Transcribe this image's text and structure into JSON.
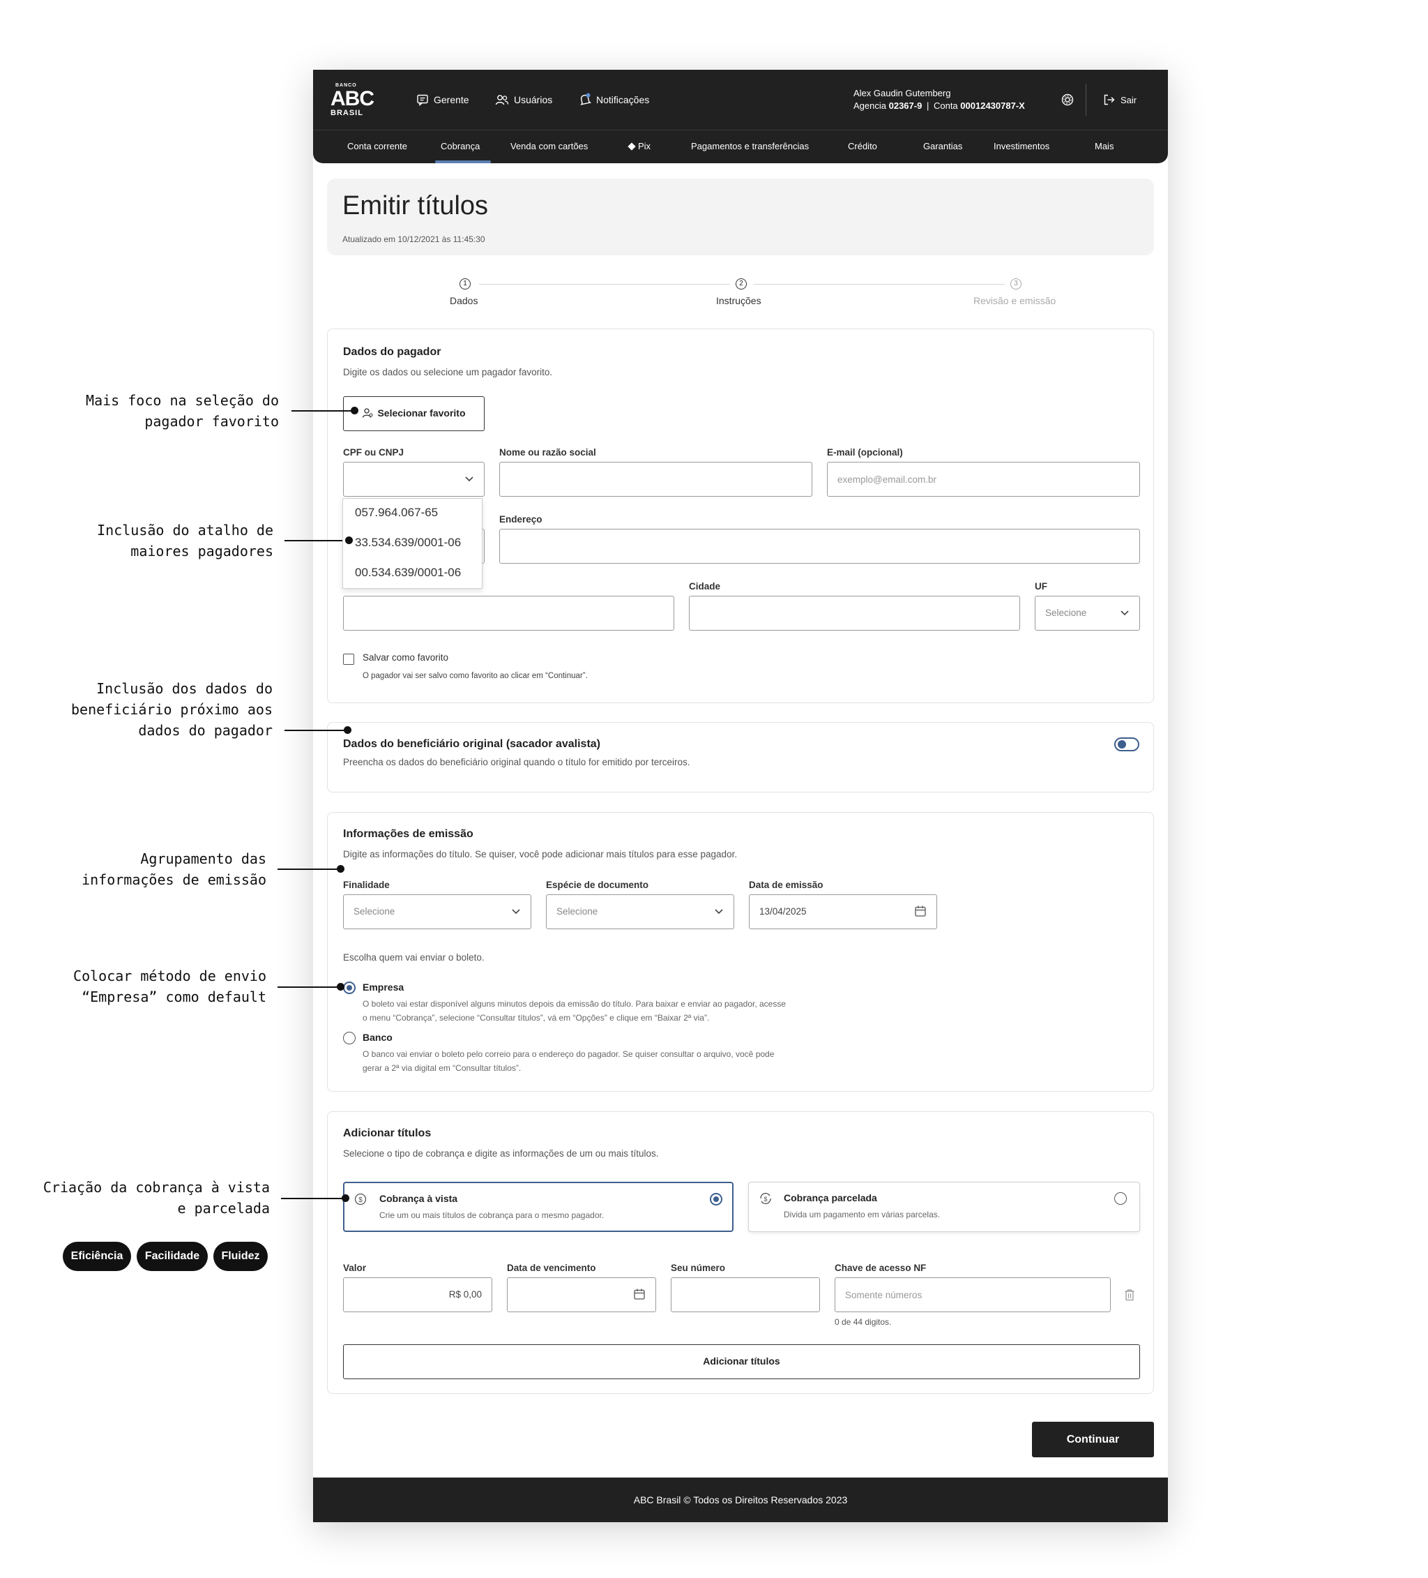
{
  "app": {
    "logo": {
      "small": "BANCO",
      "main": "ABC",
      "sub": "BRASIL"
    },
    "top_nav": [
      {
        "label": "Gerente",
        "icon": "chat-icon"
      },
      {
        "label": "Usuários",
        "icon": "users-icon"
      },
      {
        "label": "Notificações",
        "icon": "bell-icon"
      }
    ],
    "user": {
      "name": "Alex Gaudin Gutemberg",
      "agency_label": "Agencia",
      "agency": "02367-9",
      "account_label": "Conta",
      "account": "00012430787-X",
      "separator": "|"
    },
    "logout_label": "Sair",
    "main_nav": [
      "Conta corrente",
      "Cobrança",
      "Venda com cartões",
      "Pix",
      "Pagamentos e transferências",
      "Crédito",
      "Garantias",
      "Investimentos",
      "Mais"
    ],
    "active_nav": "Cobrança"
  },
  "page": {
    "title": "Emitir títulos",
    "updated": "Atualizado em 10/12/2021 às 11:45:30"
  },
  "stepper": [
    {
      "num": "1",
      "label": "Dados",
      "state": "active"
    },
    {
      "num": "2",
      "label": "Instruções",
      "state": "active"
    },
    {
      "num": "3",
      "label": "Revisão e emissão",
      "state": "inactive"
    }
  ],
  "payer": {
    "title": "Dados do pagador",
    "subtitle": "Digite os dados ou selecione um pagador favorito.",
    "select_favorite_label": "Selecionar favorito",
    "cpf_label": "CPF ou CNPJ",
    "name_label": "Nome ou razão social",
    "email_label": "E-mail (opcional)",
    "email_placeholder": "exemplo@email.com.br",
    "address_label": "Endereço",
    "city_label": "Cidade",
    "uf_label": "UF",
    "uf_placeholder": "Selecione",
    "cpf_options": [
      "057.964.067-65",
      "33.534.639/0001-06",
      "00.534.639/0001-06"
    ],
    "save_favorite_label": "Salvar como favorito",
    "save_favorite_hint": "O pagador vai ser salvo como favorito ao clicar em “Continuar”."
  },
  "beneficiary": {
    "title": "Dados do beneficiário original (sacador avalista)",
    "subtitle": "Preencha os dados do beneficiário original quando o título for emitido por terceiros.",
    "toggle_on": true
  },
  "emission": {
    "title": "Informações de emissão",
    "subtitle": "Digite as informações do título. Se quiser, você pode adicionar mais títulos para esse pagador.",
    "purpose_label": "Finalidade",
    "purpose_placeholder": "Selecione",
    "doc_type_label": "Espécie de documento",
    "doc_type_placeholder": "Selecione",
    "date_label": "Data de emissão",
    "date_value": "13/04/2025",
    "sender_question": "Escolha quem vai enviar o boleto.",
    "options": [
      {
        "label": "Empresa",
        "selected": true,
        "desc1": "O boleto vai estar disponível alguns minutos depois da emissão do título. Para baixar e enviar ao pagador, acesse",
        "desc2": "o menu “Cobrança”, selecione “Consultar títulos”, vá em “Opções” e clique em “Baixar 2ª via”."
      },
      {
        "label": "Banco",
        "selected": false,
        "desc1": "O banco vai enviar o boleto pelo correio para o endereço do pagador. Se quiser consultar o arquivo, você pode",
        "desc2": "gerar a 2ª via digital em “Consultar títulos”."
      }
    ]
  },
  "titles": {
    "title": "Adicionar títulos",
    "subtitle": "Selecione o tipo de cobrança e digite as informações de um ou mais títulos.",
    "choices": [
      {
        "label": "Cobrança à vista",
        "desc": "Crie um ou mais títulos de cobrança para o mesmo pagador.",
        "selected": true,
        "icon": "dollar-circle-icon"
      },
      {
        "label": "Cobrança parcelada",
        "desc": "Divida um pagamento em várias parcelas.",
        "selected": false,
        "icon": "recurring-dollar-icon"
      }
    ],
    "value_label": "Valor",
    "value_value": "R$ 0,00",
    "due_date_label": "Data de vencimento",
    "our_number_label": "Seu número",
    "nf_key_label": "Chave de acesso NF",
    "nf_key_placeholder": "Somente números",
    "nf_key_counter": "0 de 44 digitos.",
    "add_button": "Adicionar títulos"
  },
  "continue_button": "Continuar",
  "footer": "ABC Brasil © Todos os Direitos Reservados 2023",
  "annotations": [
    {
      "line1": "Mais foco na seleção do",
      "line2": "pagador favorito"
    },
    {
      "line1": "Inclusão do atalho de",
      "line2": "maiores pagadores"
    },
    {
      "line1": "Inclusão dos dados do",
      "line2": "beneficiário próximo aos",
      "line3": "dados do pagador"
    },
    {
      "line1": "Agrupamento das",
      "line2": "informações de emissão"
    },
    {
      "line1": "Colocar método de envio",
      "line2": "“Empresa” como default"
    },
    {
      "line1": "Criação da cobrança à vista",
      "line2": "e parcelada"
    }
  ],
  "tags": [
    "Eficiência",
    "Facilidade",
    "Fluidez"
  ]
}
